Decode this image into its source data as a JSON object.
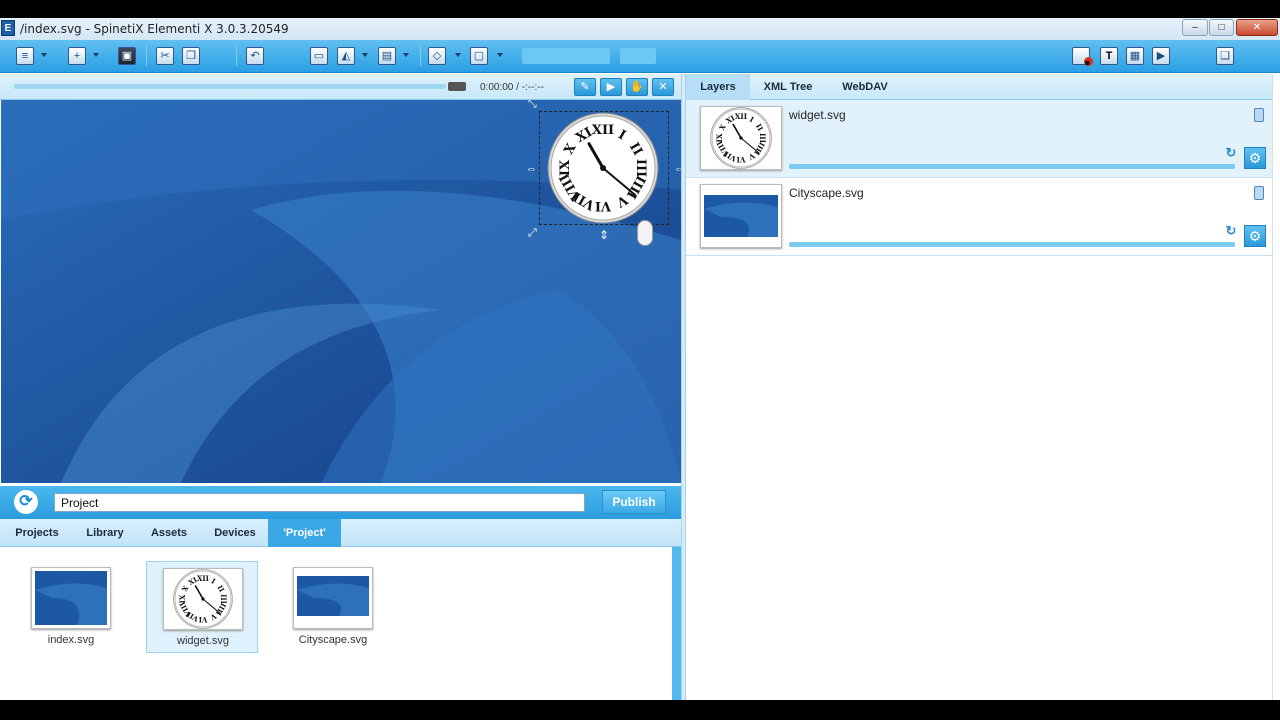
{
  "window": {
    "title": "/index.svg - SpinetiX Elementi X 3.0.3.20549",
    "app_icon": "E",
    "controls": [
      "minimize",
      "maximize",
      "close"
    ],
    "control_icons": {
      "minimize": "–",
      "maximize": "□",
      "close": "✕"
    }
  },
  "toolbar": {
    "icons": {
      "menu": "≡",
      "new_file": "+",
      "save": "▣",
      "cut": "✂",
      "copy": "❐",
      "undo": "↶",
      "rect_layer": "▭",
      "shape_tools": "◭",
      "print": "▤",
      "fill": "◇",
      "frame": "▢",
      "new_image": "●",
      "new_text": "T",
      "new_media": "▦",
      "new_video": "▶",
      "document": "❏"
    }
  },
  "preview": {
    "time": "0:00:00 / -:--:--",
    "icons": {
      "pin": "✎",
      "play": "▶",
      "hand": "✋",
      "close": "✕"
    }
  },
  "publish_bar": {
    "refresh_icon": "⟳",
    "project_value": "Project",
    "publish_label": "Publish"
  },
  "lower_tabs": [
    {
      "label": "Projects",
      "active": false
    },
    {
      "label": "Library",
      "active": false
    },
    {
      "label": "Assets",
      "active": false
    },
    {
      "label": "Devices",
      "active": false
    },
    {
      "label": "'Project'",
      "active": true
    }
  ],
  "assets": [
    {
      "label": "index.svg",
      "thumb": "blue",
      "selected": false
    },
    {
      "label": "widget.svg",
      "thumb": "clock",
      "selected": true
    },
    {
      "label": "Cityscape.svg",
      "thumb": "blue",
      "selected": false
    }
  ],
  "right_tabs": [
    {
      "label": "Layers",
      "active": true
    },
    {
      "label": "XML Tree",
      "active": false
    },
    {
      "label": "WebDAV",
      "active": false
    }
  ],
  "layers": [
    {
      "name": "widget.svg",
      "thumb": "clock",
      "selected": true,
      "loop_icon": "↻",
      "gear_icon": "⚙"
    },
    {
      "name": "Cityscape.svg",
      "thumb": "blue",
      "selected": false,
      "loop_icon": "↻",
      "gear_icon": "⚙"
    }
  ],
  "clock": {
    "numerals": [
      "XII",
      "I",
      "II",
      "III",
      "IIII",
      "V",
      "VI",
      "VII",
      "VIII",
      "IX",
      "X",
      "XI"
    ],
    "hour_hand_deg": 330,
    "minute_hand_deg": 130
  },
  "colors": {
    "accent": "#2aa0e5",
    "canvas_blue": "#1c5aa6"
  }
}
